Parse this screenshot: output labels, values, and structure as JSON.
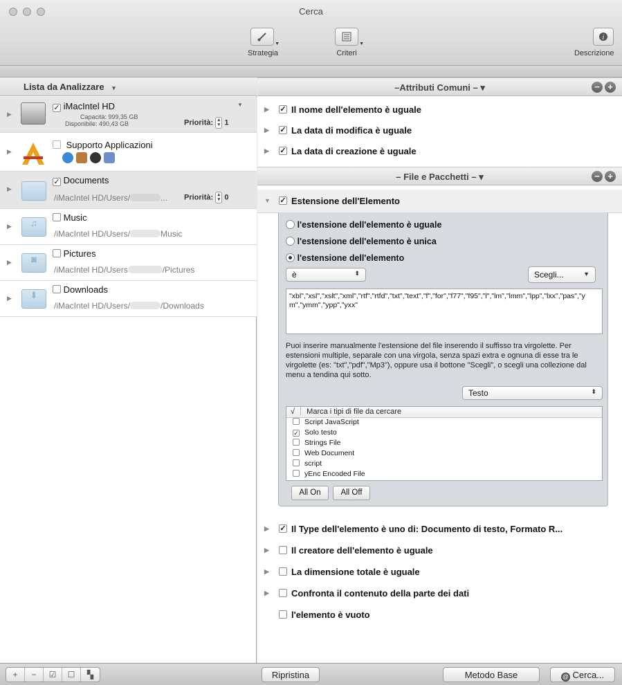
{
  "window": {
    "title": "Cerca"
  },
  "toolbar": {
    "strategia": "Strategia",
    "criteri": "Criteri",
    "descrizione": "Descrizione"
  },
  "left": {
    "header": "Lista da Analizzare",
    "header_arrow": "▾",
    "rows": [
      {
        "name": "iMacIntel HD",
        "checked": true,
        "capacity": "Capacità: 999,35 GB",
        "available": "Disponibile: 490,43 GB",
        "priority_label": "Priorità:",
        "priority": "1"
      },
      {
        "name": "Supporto Applicazioni",
        "checked": false
      },
      {
        "name": "Documents",
        "checked": true,
        "path": "/iMacIntel HD/Users/",
        "path_tail": "...",
        "priority_label": "Priorità:",
        "priority": "0"
      },
      {
        "name": "Music",
        "checked": false,
        "path": "/iMacIntel HD/Users/",
        "path_tail": "Music"
      },
      {
        "name": "Pictures",
        "checked": false,
        "path": "/iMacIntel HD/Users",
        "path_tail": "/Pictures"
      },
      {
        "name": "Downloads",
        "checked": false,
        "path": "/iMacIntel HD/Users/",
        "path_tail": "/Downloads"
      }
    ]
  },
  "right": {
    "sections": [
      {
        "title": "–Attributi Comuni – ▾"
      },
      {
        "title": "– File e Pacchetti – ▾"
      }
    ],
    "common": [
      {
        "label": "Il nome dell'elemento è uguale",
        "checked": true
      },
      {
        "label": "La data di modifica è uguale",
        "checked": true
      },
      {
        "label": "La data di creazione è uguale",
        "checked": true
      }
    ],
    "extension": {
      "label": "Estensione dell'Elemento",
      "checked": true,
      "options": [
        {
          "label": "l'estensione dell'elemento è uguale",
          "selected": false
        },
        {
          "label": "l'estensione dell'elemento è unica",
          "selected": false
        },
        {
          "label": "l'estensione dell'elemento",
          "selected": true
        }
      ],
      "operator": "è",
      "choose": "Scegli...",
      "value": "\"xbl\",\"xsl\",\"xslt\",\"xml\",\"rtf\",\"rtfd\",\"txt\",\"text\",\"f\",\"for\",\"f77\",\"f95\",\"l\",\"lm\",\"lmm\",\"lpp\",\"lxx\",\"pas\",\"ym\",\"ymm\",\"ypp\",\"yxx\"",
      "help": "Puoi inserire manualmente l'estensione del file inserendo il suffisso tra virgolette. Per estensioni multiple, separale con una virgola, senza spazi extra e ognuna di esse tra le virgolette (es: \"txt\",\"pdf\",\"Mp3\"), oppure usa il bottone \"Scegli\", o scegli una collezione dal menu a tendina qui sotto.",
      "collection": "Testo",
      "types_header": "Marca i tipi di file da cercare",
      "types": [
        {
          "label": "Script JavaScript",
          "checked": false
        },
        {
          "label": "Solo testo",
          "checked": true
        },
        {
          "label": "Strings File",
          "checked": false
        },
        {
          "label": "Web Document",
          "checked": false
        },
        {
          "label": "script",
          "checked": false
        },
        {
          "label": "yEnc Encoded File",
          "checked": false
        }
      ],
      "all_on": "All On",
      "all_off": "All Off"
    },
    "more": [
      {
        "label": "Il Type dell'elemento è uno di: Documento di testo, Formato R...",
        "checked": true
      },
      {
        "label": "Il creatore dell'elemento è uguale",
        "checked": false
      },
      {
        "label": "La dimensione totale è uguale",
        "checked": false
      },
      {
        "label": "Confronta il contenuto della parte dei dati",
        "checked": false
      },
      {
        "label": "l'elemento è vuoto",
        "checked": false
      }
    ]
  },
  "bottom": {
    "ripristina": "Ripristina",
    "metodo_base": "Metodo Base",
    "cerca": "Cerca..."
  }
}
